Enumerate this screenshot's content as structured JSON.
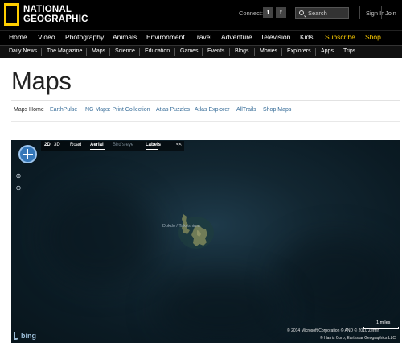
{
  "header": {
    "logo_line1": "NATIONAL",
    "logo_line2": "GEOGRAPHIC",
    "connect_label": "Connect:",
    "facebook_glyph": "f",
    "twitter_glyph": "t",
    "search_placeholder": "Search",
    "sign_in": "Sign In",
    "join": "Join"
  },
  "main_nav": [
    "Home",
    "Video",
    "Photography",
    "Animals",
    "Environment",
    "Travel",
    "Adventure",
    "Television",
    "Kids",
    "Subscribe",
    "Shop"
  ],
  "sub_nav": [
    "Daily News",
    "The Magazine",
    "Maps",
    "Science",
    "Education",
    "Games",
    "Events",
    "Blogs",
    "Movies",
    "Explorers",
    "Apps",
    "Trips"
  ],
  "page_title": "Maps",
  "maps_nav": [
    "Maps Home",
    "EarthPulse",
    "NG Maps: Print Collection",
    "Atlas Puzzles",
    "Atlas Explorer",
    "AllTrails",
    "Shop Maps"
  ],
  "map": {
    "toolbar": {
      "2d": "2D",
      "3d": "3D",
      "road": "Road",
      "aerial": "Aerial",
      "birds_eye": "Bird's eye",
      "labels": "Labels",
      "collapse": "<<"
    },
    "zoom_in": "⊕",
    "zoom_out": "⊖",
    "place_label": "Dokdo / Takeshima",
    "scale_label": "1 miles",
    "copyright_line1": "© 2014 Microsoft Corporation   © AND   © 2010 Zenrin",
    "copyright_line2": "© Harris Corp, Earthstar Geographics LLC",
    "provider": "bing"
  },
  "colors": {
    "accent_yellow": "#ffce00",
    "link_blue": "#3a6f9a",
    "map_ocean": "#122631"
  }
}
